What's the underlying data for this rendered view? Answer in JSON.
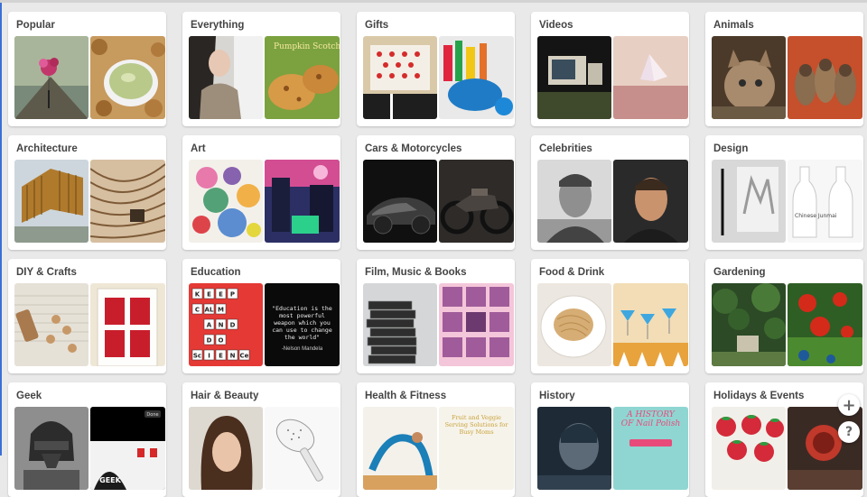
{
  "categories": [
    {
      "title": "Popular"
    },
    {
      "title": "Everything",
      "thumb_text": "Pumpkin Scotchies"
    },
    {
      "title": "Gifts"
    },
    {
      "title": "Videos"
    },
    {
      "title": "Animals"
    },
    {
      "title": "Architecture"
    },
    {
      "title": "Art"
    },
    {
      "title": "Cars & Motorcycles"
    },
    {
      "title": "Celebrities"
    },
    {
      "title": "Design",
      "thumb_text": "Chinese Junmai"
    },
    {
      "title": "DIY & Crafts"
    },
    {
      "title": "Education",
      "tiles": [
        [
          "K",
          "E",
          "E",
          "P"
        ],
        [
          "C",
          "AL",
          "M"
        ],
        [
          "A",
          "N",
          "D"
        ],
        [
          "D",
          "O"
        ],
        [
          "Sc",
          "I",
          "E",
          "N",
          "Ce"
        ]
      ],
      "quote": "\"Education is the most powerful weapon which you can use to change the world\"",
      "quote_author": "-Nelson Mandela"
    },
    {
      "title": "Film, Music & Books"
    },
    {
      "title": "Food & Drink"
    },
    {
      "title": "Gardening"
    },
    {
      "title": "Geek",
      "thumb_text": "GEEK",
      "thumb_badge": "Done"
    },
    {
      "title": "Hair & Beauty"
    },
    {
      "title": "Health & Fitness",
      "thumb_text": "Fruit and Veggie Serving Solutions for Busy Moms"
    },
    {
      "title": "History",
      "thumb_text": "A HISTORY OF Nail Polish"
    },
    {
      "title": "Holidays & Events"
    }
  ],
  "floating": {
    "plus": "+",
    "help": "?"
  }
}
